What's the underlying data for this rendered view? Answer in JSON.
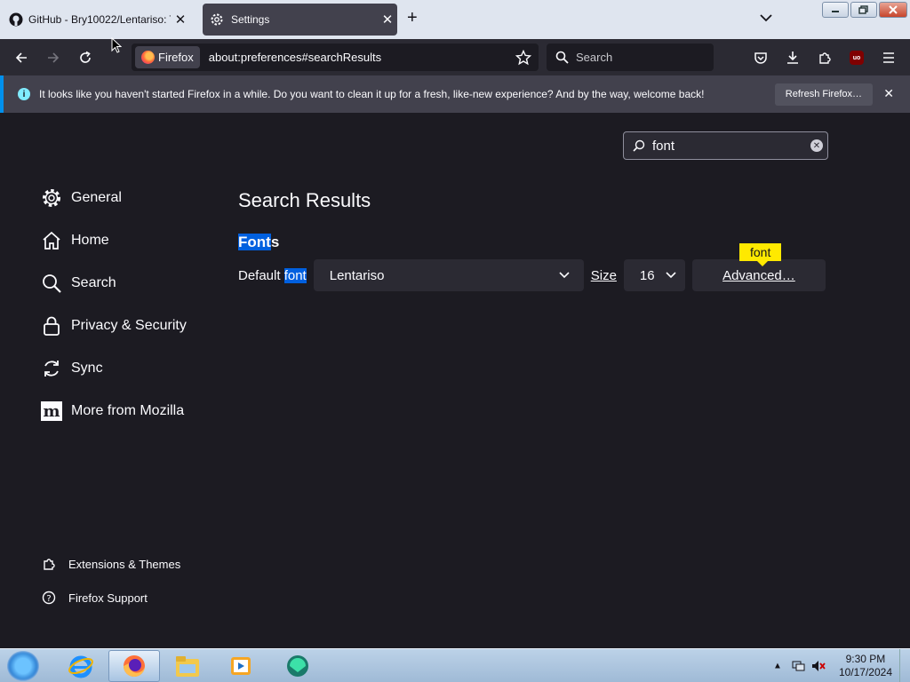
{
  "tabs": [
    {
      "title": "GitHub - Bry10022/Lentariso: Th",
      "close": "✕",
      "icon": "github-icon"
    },
    {
      "title": "Settings",
      "close": "✕",
      "icon": "gear-icon"
    }
  ],
  "new_tab": "+",
  "navbar": {
    "identity_label": "Firefox",
    "url": "about:preferences#searchResults",
    "search_placeholder": "Search"
  },
  "notification": {
    "text": "It looks like you haven't started Firefox in a while. Do you want to clean it up for a fresh, like-new experience? And by the way, welcome back!",
    "button": "Refresh Firefox…",
    "close": "✕"
  },
  "find": {
    "value": "font"
  },
  "sidebar": {
    "categories": [
      {
        "label": "General",
        "icon": "gear-icon"
      },
      {
        "label": "Home",
        "icon": "home-icon"
      },
      {
        "label": "Search",
        "icon": "search-icon"
      },
      {
        "label": "Privacy & Security",
        "icon": "lock-icon"
      },
      {
        "label": "Sync",
        "icon": "sync-icon"
      },
      {
        "label": "More from Mozilla",
        "icon": "mozilla-icon"
      }
    ],
    "footer": [
      {
        "label": "Extensions & Themes",
        "icon": "puzzle-icon"
      },
      {
        "label": "Firefox Support",
        "icon": "help-icon"
      }
    ]
  },
  "main": {
    "title": "Search Results",
    "section": {
      "heading_hl": "Font",
      "heading_rest": "s"
    },
    "default_font_label_pre": "Default ",
    "default_font_label_hl": "font",
    "font_value": "Lentariso",
    "size_label": "Size",
    "size_value": "16",
    "advanced_button": "Advanced…",
    "tooltip": "font"
  },
  "taskbar": {
    "time": "9:30 PM",
    "date": "10/17/2024",
    "apps": [
      "internet-explorer-icon",
      "firefox-icon",
      "file-explorer-icon",
      "media-player-icon",
      "app-icon"
    ]
  },
  "ublock_label": "uo"
}
